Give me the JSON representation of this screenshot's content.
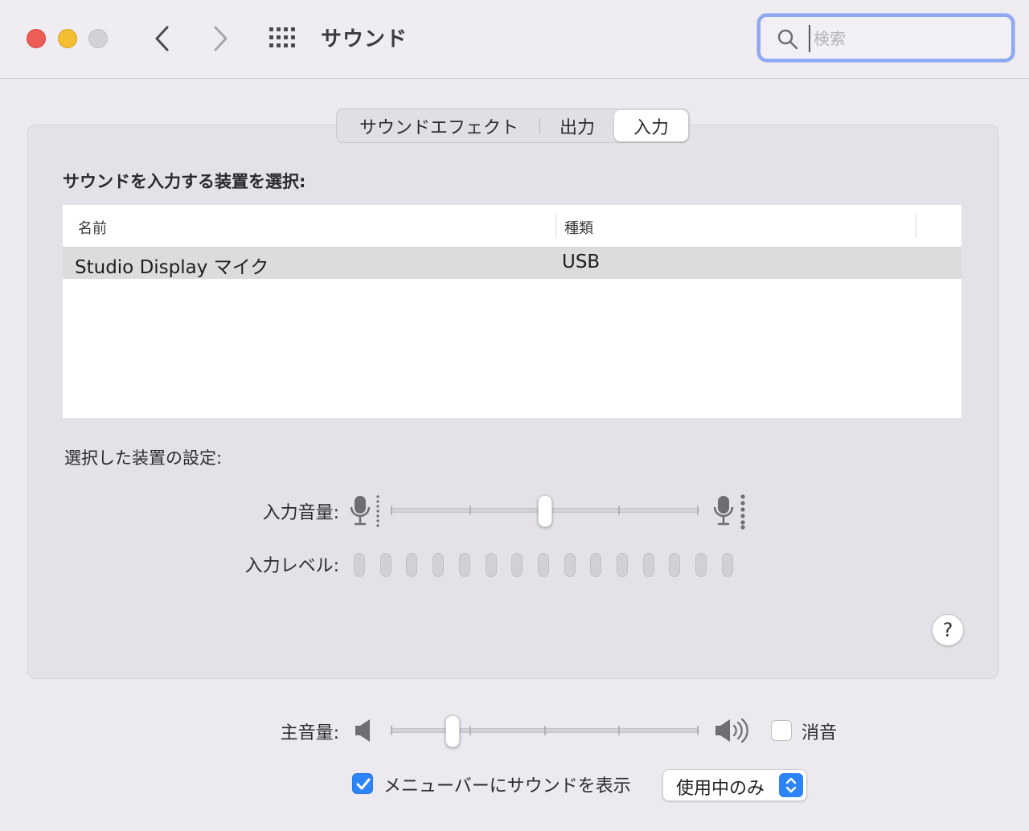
{
  "window": {
    "title": "サウンド"
  },
  "search": {
    "placeholder": "検索",
    "value": ""
  },
  "tabs": [
    {
      "label": "サウンドエフェクト",
      "active": false
    },
    {
      "label": "出力",
      "active": false
    },
    {
      "label": "入力",
      "active": true
    }
  ],
  "input_panel": {
    "title": "サウンドを入力する装置を選択:",
    "table": {
      "columns": [
        "名前",
        "種類"
      ],
      "rows": [
        {
          "name": "Studio Display マイク",
          "type": "USB",
          "selected": true
        }
      ]
    },
    "settings_title": "選択した装置の設定:",
    "input_volume_label": "入力音量:",
    "input_volume_value": 0.5,
    "input_level_label": "入力レベル:",
    "input_level_cells": 15,
    "input_level_active": 0
  },
  "help": {
    "label": "?"
  },
  "output_volume": {
    "label": "主音量:",
    "value": 0.2
  },
  "mute": {
    "label": "消音",
    "checked": false
  },
  "show_in_menubar": {
    "label": "メニューバーにサウンドを表示",
    "checked": true
  },
  "menubar_popup": {
    "value": "使用中のみ"
  },
  "colors": {
    "accent": "#2c84f7",
    "search_focus": "#8fa8f0",
    "close": "#ee5c57",
    "minimize": "#f5bd31",
    "zoom": "#d3d1d5"
  }
}
